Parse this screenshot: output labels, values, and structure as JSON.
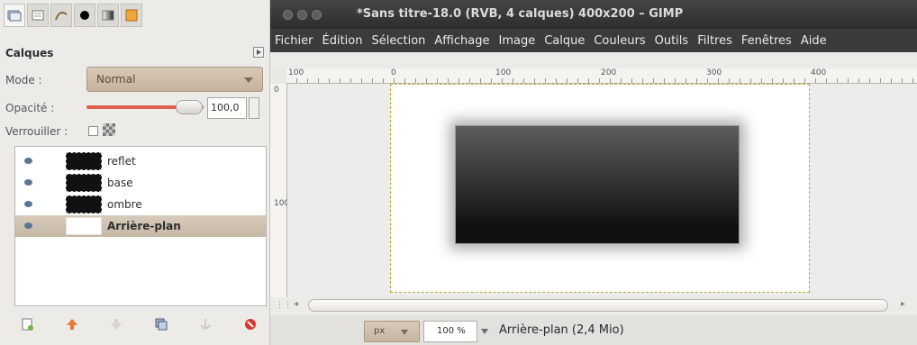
{
  "dock": {
    "tabs": [
      "layers-tab",
      "channels-tab",
      "paths-tab",
      "brushes-tab",
      "gradients-tab",
      "patterns-tab"
    ],
    "panel_title": "Calques",
    "mode_label": "Mode :",
    "mode_value": "Normal",
    "opacity_label": "Opacité :",
    "opacity_value": "100,0",
    "opacity_fraction": 1.0,
    "lock_label": "Verrouiller :",
    "layers": [
      {
        "name": "reflet",
        "visible": true,
        "selected": false
      },
      {
        "name": "base",
        "visible": true,
        "selected": false
      },
      {
        "name": "ombre",
        "visible": true,
        "selected": false
      },
      {
        "name": "Arrière-plan",
        "visible": true,
        "selected": true
      }
    ],
    "toolbar_icons": [
      "new-layer-icon",
      "raise-layer-icon",
      "lower-layer-icon",
      "duplicate-layer-icon",
      "anchor-layer-icon",
      "delete-layer-icon"
    ]
  },
  "window": {
    "title": "*Sans titre-18.0 (RVB, 4 calques) 400x200 – GIMP",
    "menu": [
      "Fichier",
      "Édition",
      "Sélection",
      "Affichage",
      "Image",
      "Calque",
      "Couleurs",
      "Outils",
      "Filtres",
      "Fenêtres",
      "Aide"
    ]
  },
  "ruler": {
    "labels": [
      "100",
      "0",
      "100",
      "200",
      "300",
      "400"
    ],
    "left_labels": [
      "0",
      "100"
    ]
  },
  "status": {
    "unit": "px",
    "zoom": "100 %",
    "text": "Arrière-plan (2,4 Mio)"
  },
  "colors": {
    "accent": "#e0604d",
    "selected_row": "#c6b7a5",
    "titlebar": "#2d2d2d"
  }
}
